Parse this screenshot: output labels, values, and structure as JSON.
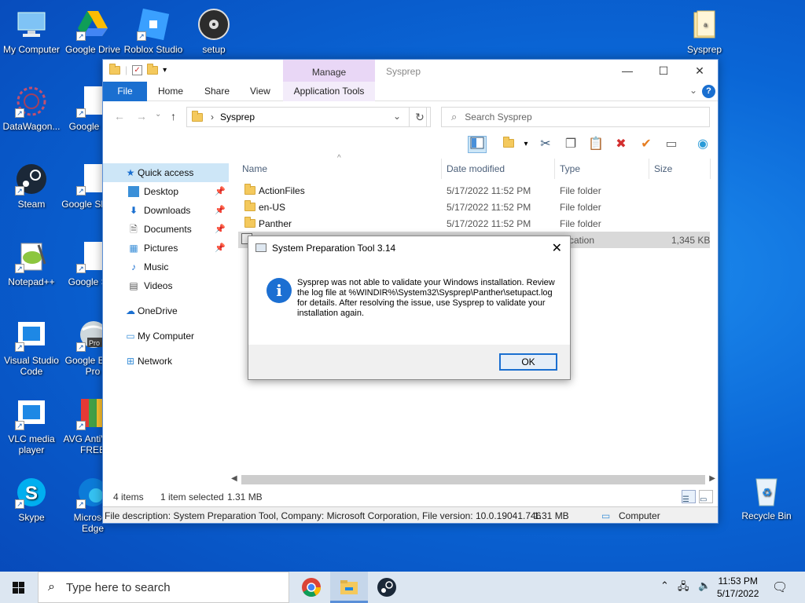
{
  "desktop": {
    "icons": [
      {
        "name": "my-computer",
        "label": "My Computer"
      },
      {
        "name": "google-drive",
        "label": "Google Drive"
      },
      {
        "name": "roblox-studio",
        "label": "Roblox Studio"
      },
      {
        "name": "setup",
        "label": "setup"
      },
      {
        "name": "sysprep-folder",
        "label": "Sysprep"
      },
      {
        "name": "datawagon",
        "label": "DataWagon..."
      },
      {
        "name": "google-docs",
        "label": "Google D..."
      },
      {
        "name": "steam",
        "label": "Steam"
      },
      {
        "name": "google-sheets",
        "label": "Google Sheets"
      },
      {
        "name": "notepadpp",
        "label": "Notepad++"
      },
      {
        "name": "google-slides",
        "label": "Google Sl..."
      },
      {
        "name": "vscode",
        "label": "Visual Studio Code"
      },
      {
        "name": "google-earth",
        "label": "Google Earth Pro"
      },
      {
        "name": "vlc",
        "label": "VLC media player"
      },
      {
        "name": "avg",
        "label": "AVG AntiVirus FREE"
      },
      {
        "name": "skype",
        "label": "Skype"
      },
      {
        "name": "edge",
        "label": "Microsoft Edge"
      },
      {
        "name": "recycle-bin",
        "label": "Recycle Bin"
      }
    ]
  },
  "explorer": {
    "title": "Sysprep",
    "manage_label": "Manage",
    "tabs": {
      "file": "File",
      "home": "Home",
      "share": "Share",
      "view": "View",
      "app_tools": "Application Tools"
    },
    "address": "Sysprep",
    "search_placeholder": "Search Sysprep",
    "sidebar": {
      "quick_access": "Quick access",
      "desktop": "Desktop",
      "downloads": "Downloads",
      "documents": "Documents",
      "pictures": "Pictures",
      "music": "Music",
      "videos": "Videos",
      "onedrive": "OneDrive",
      "my_computer": "My Computer",
      "network": "Network"
    },
    "columns": {
      "name": "Name",
      "date": "Date modified",
      "type": "Type",
      "size": "Size"
    },
    "files": [
      {
        "name": "ActionFiles",
        "date": "5/17/2022 11:52 PM",
        "type": "File folder",
        "size": ""
      },
      {
        "name": "en-US",
        "date": "5/17/2022 11:52 PM",
        "type": "File folder",
        "size": ""
      },
      {
        "name": "Panther",
        "date": "5/17/2022 11:52 PM",
        "type": "File folder",
        "size": ""
      },
      {
        "name": "",
        "date": "",
        "type": "plication",
        "size": "1,345 KB"
      }
    ],
    "status": {
      "items": "4 items",
      "selected": "1 item selected",
      "size": "1.31 MB"
    },
    "description": {
      "text": "File description: System Preparation Tool, Company: Microsoft Corporation, File version: 10.0.19041.746",
      "size": "1.31 MB",
      "location": "Computer"
    }
  },
  "dialog": {
    "title": "System Preparation Tool 3.14",
    "message": "Sysprep was not able to validate your Windows installation. Review the log file at %WINDIR%\\System32\\Sysprep\\Panther\\setupact.log for details. After resolving the issue, use Sysprep to validate your installation again.",
    "ok_label": "OK"
  },
  "taskbar": {
    "search_placeholder": "Type here to search",
    "time": "11:53 PM",
    "date": "5/17/2022"
  },
  "colors": {
    "accent": "#1a6fd0",
    "manage_tab": "#e9d7f6",
    "selection": "#cde6f7"
  }
}
